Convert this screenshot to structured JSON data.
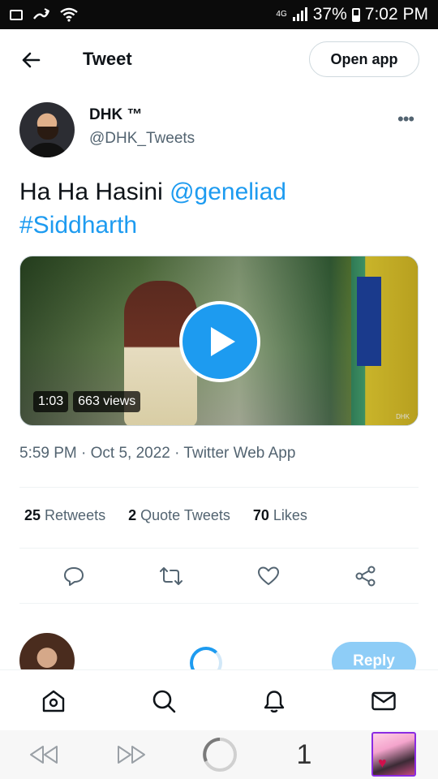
{
  "status_bar": {
    "network": "4G",
    "battery": "37%",
    "time": "7:02 PM"
  },
  "header": {
    "title": "Tweet",
    "open_app_label": "Open app"
  },
  "tweet": {
    "display_name": "DHK ™",
    "handle": "@DHK_Tweets",
    "text_plain": "Ha Ha Hasini",
    "mention": "@geneliad",
    "hashtag": "#Siddharth",
    "media": {
      "duration": "1:03",
      "views": "663 views",
      "watermark": "DHK"
    },
    "timestamp": "5:59 PM · Oct 5, 2022 · Twitter Web App",
    "stats": {
      "retweets_count": "25",
      "retweets_label": "Retweets",
      "quotes_count": "2",
      "quotes_label": "Quote Tweets",
      "likes_count": "70",
      "likes_label": "Likes"
    }
  },
  "composer": {
    "reply_label": "Reply"
  },
  "browser": {
    "tab_count": "1"
  },
  "colors": {
    "accent": "#1d9bf0",
    "secondary_text": "#536471",
    "reply_disabled": "#8ecdf7"
  }
}
